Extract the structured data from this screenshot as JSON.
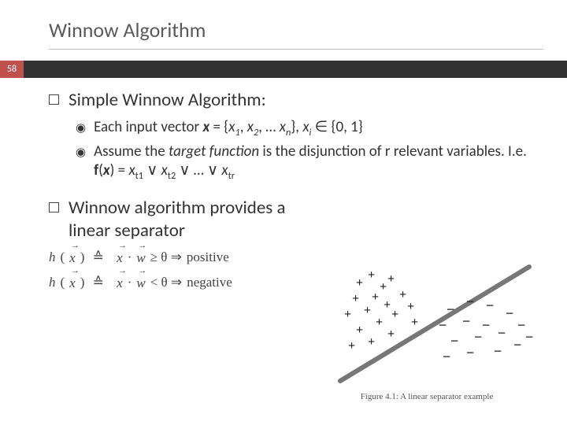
{
  "slide": {
    "title": "Winnow Algorithm",
    "page_number": "58"
  },
  "bullets": [
    {
      "text": "Simple Winnow Algorithm:",
      "subs": [
        {
          "prefix": "Each input vector ",
          "expr": "x = {x₁, x₂, … xₙ}, xᵢ ∈ {0, 1}"
        },
        {
          "prefix": "Assume the ",
          "mid1": "target function",
          "mid2": " is the disjunction of r relevant variables. I.e. ",
          "expr2": "f(x) = xₜ₁ ∨ xₜ₂ ∨ … ∨ xₜᵣ"
        }
      ]
    },
    {
      "text": "Winnow algorithm provides a linear separator",
      "subs": []
    }
  ],
  "math": {
    "line1_lhs": "h(x⃗)",
    "line1_def": "≙",
    "line1_mid": "x⃗ · w⃗ ≥ θ ⇒",
    "line1_rhs": "positive",
    "line2_lhs": "h(x⃗)",
    "line2_def": "≙",
    "line2_mid": "x⃗ · w⃗ < θ ⇒",
    "line2_rhs": "negative"
  },
  "figure": {
    "caption": "Figure 4.1: A linear separator example"
  }
}
